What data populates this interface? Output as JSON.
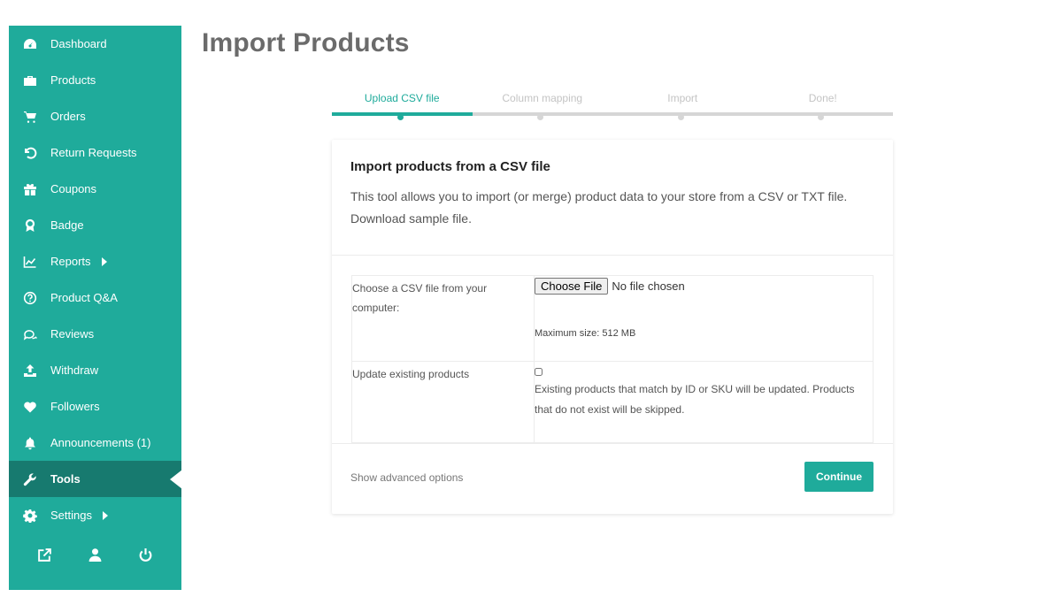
{
  "sidebar": {
    "items": [
      {
        "label": "Dashboard",
        "icon": "dashboard-icon"
      },
      {
        "label": "Products",
        "icon": "briefcase-icon"
      },
      {
        "label": "Orders",
        "icon": "cart-icon"
      },
      {
        "label": "Return Requests",
        "icon": "undo-icon"
      },
      {
        "label": "Coupons",
        "icon": "gift-icon"
      },
      {
        "label": "Badge",
        "icon": "award-icon"
      },
      {
        "label": "Reports",
        "icon": "chart-icon"
      },
      {
        "label": "Product Q&A",
        "icon": "question-circle-icon"
      },
      {
        "label": "Reviews",
        "icon": "comments-icon"
      },
      {
        "label": "Withdraw",
        "icon": "upload-icon"
      },
      {
        "label": "Followers",
        "icon": "heart-icon"
      },
      {
        "label": "Announcements (1)",
        "icon": "bell-icon"
      },
      {
        "label": "Tools",
        "icon": "wrench-icon"
      },
      {
        "label": "Settings",
        "icon": "cog-icon"
      }
    ],
    "active": "Tools",
    "footer_icons": [
      "external-link-icon",
      "user-icon",
      "power-icon"
    ]
  },
  "page": {
    "title": "Import Products"
  },
  "stepper": {
    "steps": [
      "Upload CSV file",
      "Column mapping",
      "Import",
      "Done!"
    ],
    "active_index": 0
  },
  "card": {
    "heading": "Import products from a CSV file",
    "description": "This tool allows you to import (or merge) product data to your store from a CSV or TXT file. Download sample file.",
    "fields": {
      "file_label": "Choose a CSV file from your computer:",
      "file_button": "Choose File",
      "file_status": "No file chosen",
      "max_size": "Maximum size: 512 MB",
      "update_label": "Update existing products",
      "update_checked": false,
      "update_description": "Existing products that match by ID or SKU will be updated. Products that do not exist will be skipped."
    },
    "footer": {
      "advanced_link": "Show advanced options",
      "continue_button": "Continue"
    }
  },
  "colors": {
    "accent": "#1fab9b",
    "accent_dark": "#177a6f",
    "title_gray": "#6b6b6b",
    "inactive_step": "#c4c4c4"
  }
}
